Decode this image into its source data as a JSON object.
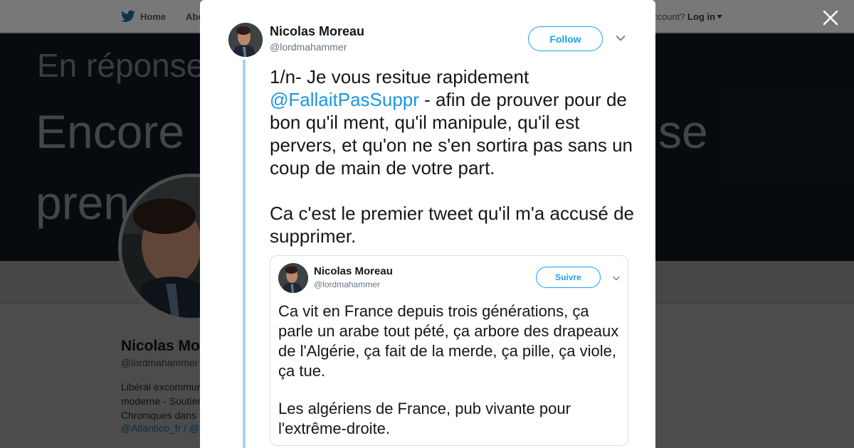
{
  "background": {
    "nav": {
      "home_label": "Home",
      "about_label": "Abe",
      "account_text": "ccount?",
      "login_label": "Log in"
    },
    "banner": {
      "line1": "En réponse",
      "line2a": "Encore u",
      "line2b": "se",
      "line3": "pren"
    },
    "profile": {
      "name": "Nicolas Mo",
      "handle": "@lordmahammer",
      "bio": [
        "Libéral excommun",
        "moderne - Soutien",
        "Chroniques dans"
      ],
      "links": [
        "@Atlantico_fr",
        " / ",
        "@"
      ]
    }
  },
  "tweet": {
    "author_name": "Nicolas Moreau",
    "author_handle": "@lordmahammer",
    "follow_label": "Follow",
    "text_before": "1/n- Je vous resitue rapidement ",
    "mention": "@FallaitPasSuppr",
    "text_after": " - afin de prouver pour de bon qu'il ment, qu'il manipule, qu'il est pervers, et qu'on ne s'en sortira pas sans un coup de main de votre part.",
    "text_paragraph2": "Ca c'est le premier tweet qu'il m'a accusé de supprimer."
  },
  "embedded_tweet": {
    "author_name": "Nicolas Moreau",
    "author_handle": "@lordmahammer",
    "follow_label": "Suivre",
    "paragraph1": "Ca vit en France depuis trois générations, ça parle un arabe tout pété, ça arbore des drapeaux de l'Algérie, ça fait de la merde, ça pille, ça viole, ça tue.",
    "paragraph2": "Les algériens de France, pub vivante pour l'extrême-droite."
  },
  "colors": {
    "accent": "#1da1f2",
    "mention": "#1b95e0",
    "thread_line": "#a6d4f2",
    "overlay": "rgba(0,0,0,0.45)"
  },
  "icons": [
    "twitter-bird-icon",
    "close-icon",
    "chevron-down-icon"
  ]
}
